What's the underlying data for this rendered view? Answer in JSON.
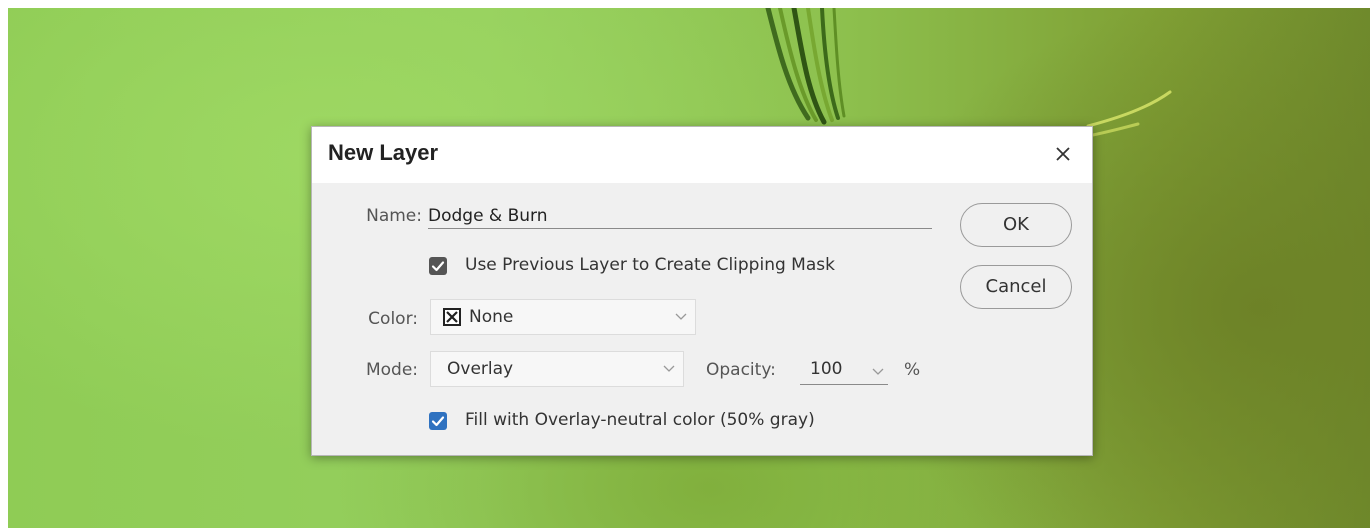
{
  "dialog": {
    "title": "New Layer",
    "name_label": "Name:",
    "name_value": "Dodge & Burn",
    "clipping_mask": {
      "label": "Use Previous Layer to Create Clipping Mask",
      "checked": true
    },
    "color_label": "Color:",
    "color_value": "None",
    "mode_label": "Mode:",
    "mode_value": "Overlay",
    "opacity_label": "Opacity:",
    "opacity_value": "100",
    "opacity_unit": "%",
    "fill_neutral": {
      "label": "Fill with Overlay-neutral color (50% gray)",
      "checked": true
    },
    "ok_label": "OK",
    "cancel_label": "Cancel"
  },
  "icons": {
    "close": "close-icon",
    "checkbox_checked": "checkmark-icon",
    "color_none": "x-box-icon",
    "dropdown": "chevron-down-icon"
  },
  "colors": {
    "dialog_bg": "#f0f0f0",
    "titlebar_bg": "#ffffff",
    "checkbox_dark": "#555555",
    "checkbox_blue": "#2f72c0"
  }
}
